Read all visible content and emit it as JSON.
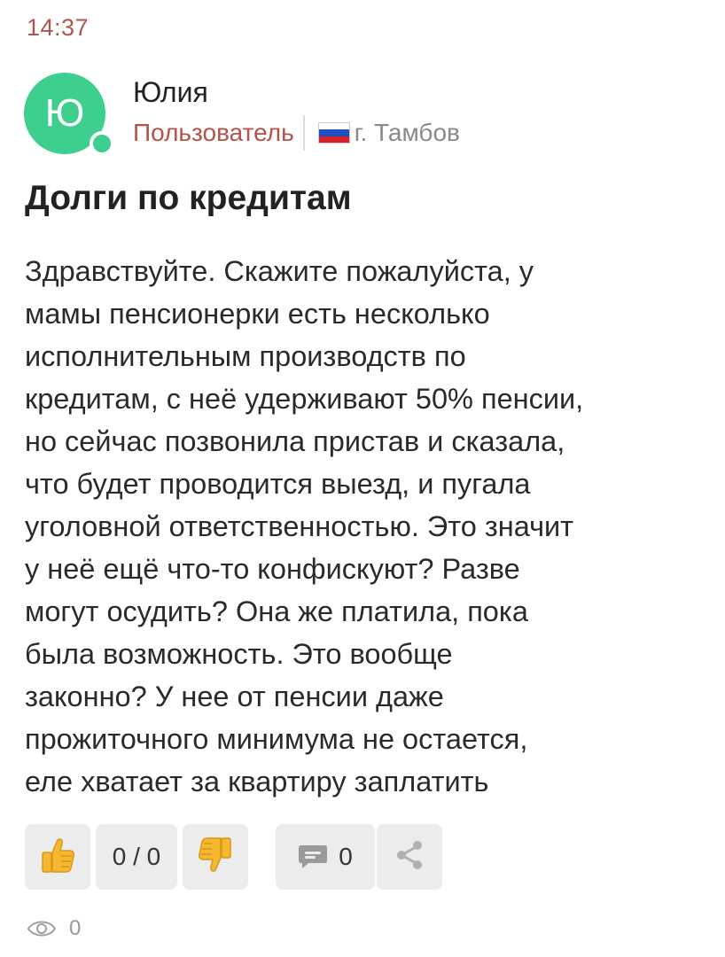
{
  "status_bar": {
    "time": "14:37"
  },
  "author": {
    "avatar_letter": "Ю",
    "avatar_color": "#3ecf8e",
    "online": true,
    "name": "Юлия",
    "role": "Пользователь",
    "country_flag": "russia-flag-icon",
    "city": "г. Тамбов"
  },
  "post": {
    "title": "Долги по кредитам",
    "body": "Здравствуйте. Скажите пожалуйста, у\nмамы пенсионерки есть несколько\nисполнительным производств по\nкредитам, с неё удерживают 50% пенсии,\nно сейчас позвонила пристав и сказала,\nчто будет проводится выезд, и пугала\nуголовной ответственностью. Это значит\nу неё ещё что-то конфискуют? Разве\nмогут осудить? Она же платила, пока\nбыла возможность. Это вообще\nзаконно? У нее от пенсии даже\nпрожиточного минимума не остается,\nеле хватает за квартиру заплатить"
  },
  "actions": {
    "like_icon": "thumbs-up-icon",
    "score": "0 / 0",
    "dislike_icon": "thumbs-down-icon",
    "comment_icon": "comment-icon",
    "comments_count": "0",
    "share_icon": "share-icon"
  },
  "stats": {
    "views_icon": "eye-icon",
    "views": "0"
  },
  "colors": {
    "accent_role": "#b5534b",
    "time": "#a8584f",
    "button_bg": "#ececec",
    "emoji_yellow": "#f5b82e"
  }
}
